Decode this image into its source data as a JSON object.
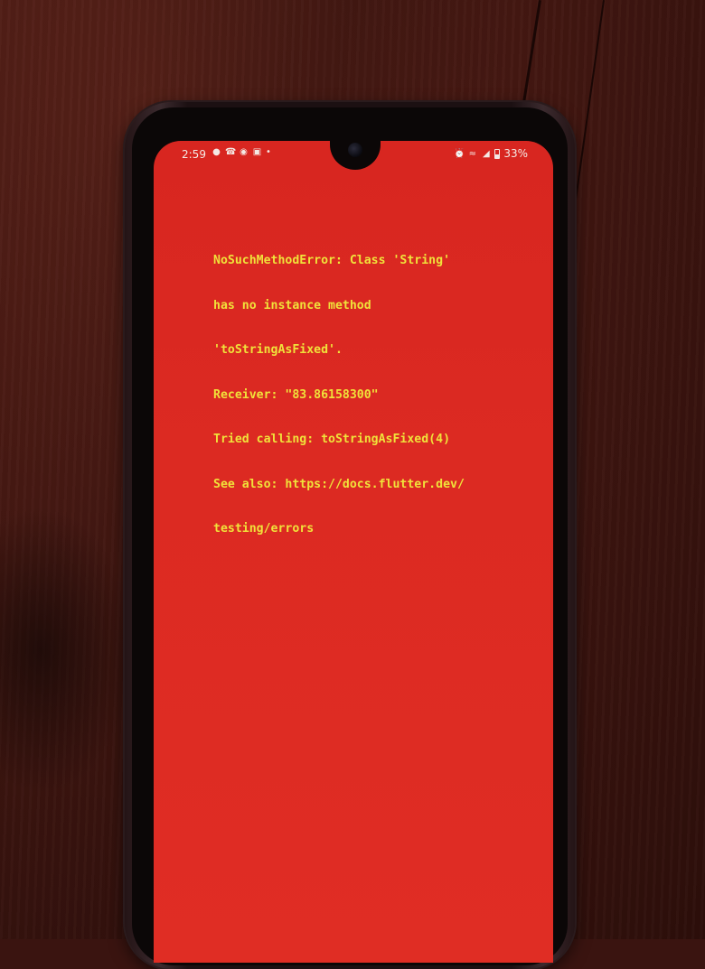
{
  "status_bar": {
    "time": "2:59",
    "battery_percent": "33%",
    "left_icons": [
      "chat-icon",
      "whatsapp-icon",
      "messenger-icon",
      "instagram-icon",
      "dot-icon"
    ],
    "right_icons": [
      "alarm-icon",
      "wifi-icon",
      "signal-icon",
      "battery-icon"
    ]
  },
  "error": {
    "lines": [
      "NoSuchMethodError: Class 'String'",
      "has no instance method",
      "'toStringAsFixed'.",
      "Receiver: \"83.86158300\"",
      "Tried calling: toStringAsFixed(4)",
      "See also: https://docs.flutter.dev/",
      "testing/errors"
    ],
    "text_color": "#f0e23a",
    "background_color": "#dc2a22"
  }
}
